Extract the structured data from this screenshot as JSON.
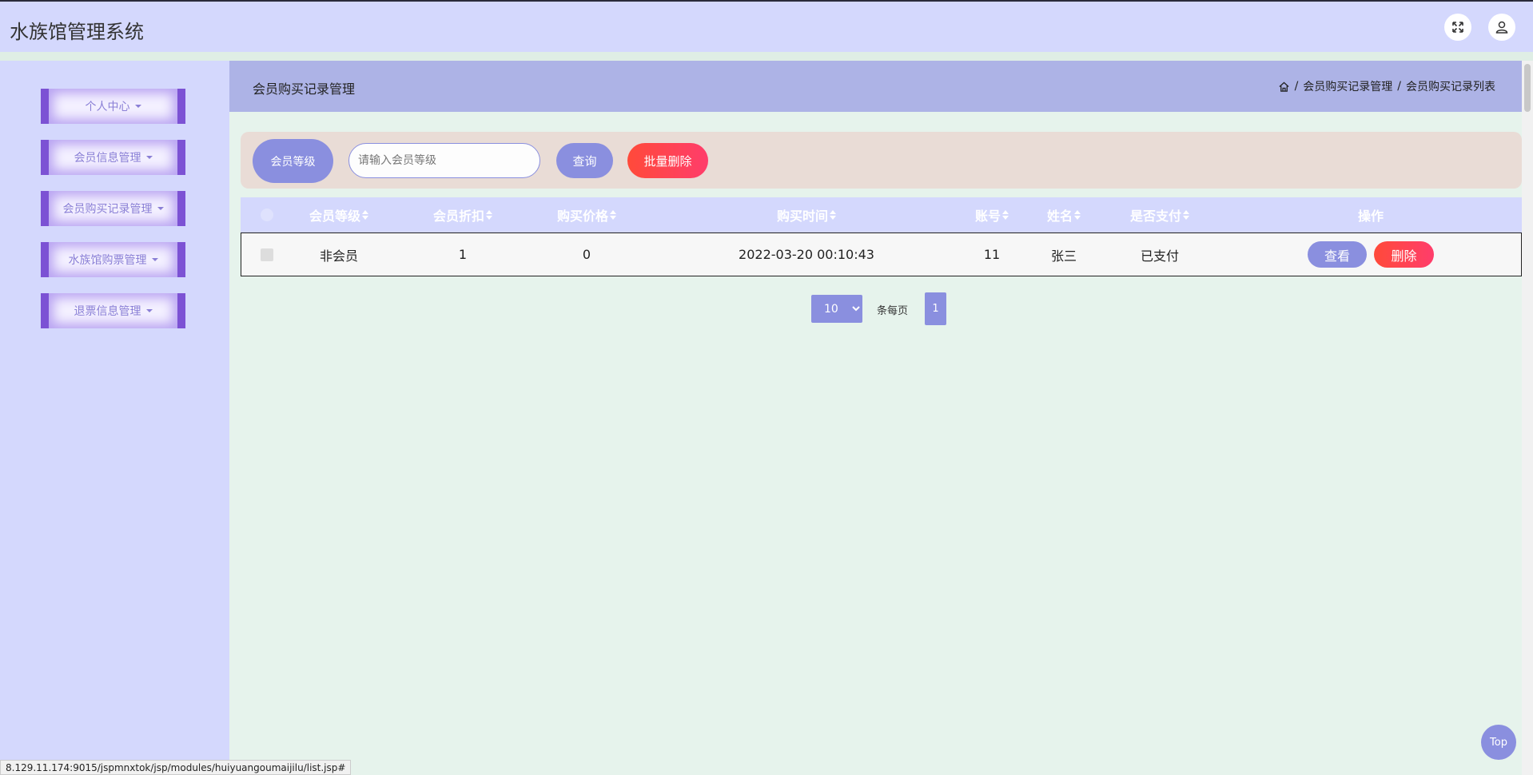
{
  "header": {
    "title": "水族馆管理系统",
    "fullscreen_icon": "expand-icon",
    "user_icon": "user-icon"
  },
  "sidebar": {
    "items": [
      {
        "label": "个人中心"
      },
      {
        "label": "会员信息管理"
      },
      {
        "label": "会员购买记录管理"
      },
      {
        "label": "水族馆购票管理"
      },
      {
        "label": "退票信息管理"
      }
    ]
  },
  "page": {
    "title": "会员购买记录管理",
    "breadcrumb": [
      "会员购买记录管理",
      "会员购买记录列表"
    ],
    "breadcrumb_sep": "/"
  },
  "search": {
    "label": "会员等级",
    "placeholder": "请输入会员等级",
    "value": "",
    "query_label": "查询",
    "batch_delete_label": "批量删除"
  },
  "table": {
    "columns": [
      "会员等级",
      "会员折扣",
      "购买价格",
      "购买时间",
      "账号",
      "姓名",
      "是否支付",
      "操作"
    ],
    "rows": [
      {
        "level": "非会员",
        "discount": "1",
        "price": "0",
        "time": "2022-03-20 00:10:43",
        "account": "11",
        "name": "张三",
        "paid": "已支付",
        "view_label": "查看",
        "delete_label": "删除"
      }
    ]
  },
  "pagination": {
    "page_size": "10",
    "per_page_label": "条每页",
    "current_page": "1"
  },
  "top_button": "Top",
  "status_url": "8.129.11.174:9015/jspmnxtok/jsp/modules/huiyuangoumaijilu/list.jsp#",
  "colors": {
    "header_bg": "#d4d8fd",
    "accent": "#8a8fdf",
    "danger": "#ff4a3a",
    "menu_border": "#7c52d4",
    "content_bg": "#e6f3ec"
  }
}
